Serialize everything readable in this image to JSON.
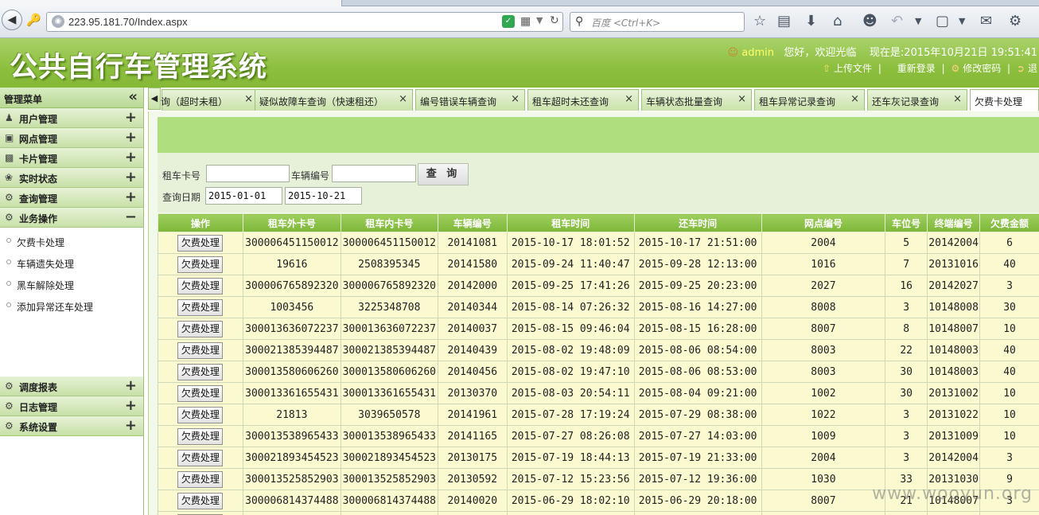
{
  "browser": {
    "url": "223.95.181.70/Index.aspx",
    "search_placeholder": "百度 <Ctrl+K>"
  },
  "app": {
    "title": "公共自行车管理系统",
    "user": "admin",
    "greeting": "您好，欢迎光临",
    "now_label": "现在是:2015年10月21日 19:51:41",
    "links": {
      "upload": "上传文件",
      "relogin": "重新登录",
      "change_password": "修改密码",
      "logout": "退"
    }
  },
  "sidebar": {
    "title": "管理菜单",
    "menus_top": [
      {
        "label": "用户管理",
        "toggle": "+"
      },
      {
        "label": "网点管理",
        "toggle": "+"
      },
      {
        "label": "卡片管理",
        "toggle": "+"
      },
      {
        "label": "实时状态",
        "toggle": "+"
      },
      {
        "label": "查询管理",
        "toggle": "+"
      },
      {
        "label": "业务操作",
        "toggle": "−"
      }
    ],
    "subitems": [
      "欠费卡处理",
      "车辆遗失处理",
      "黑车解除处理",
      "添加异常还车处理"
    ],
    "menus_bottom": [
      {
        "label": "调度报表",
        "toggle": "+"
      },
      {
        "label": "日志管理",
        "toggle": "+"
      },
      {
        "label": "系统设置",
        "toggle": "+"
      }
    ]
  },
  "tabs": [
    {
      "label": "询（超时未租）"
    },
    {
      "label": "疑似故障车查询（快速租还）"
    },
    {
      "label": "编号错误车辆查询"
    },
    {
      "label": "租车超时未还查询"
    },
    {
      "label": "车辆状态批量查询"
    },
    {
      "label": "租车异常记录查询"
    },
    {
      "label": "还车灰记录查询"
    },
    {
      "label": "欠费卡处理"
    }
  ],
  "query": {
    "card_label": "租车卡号",
    "card_value": "",
    "bike_label": "车辆编号",
    "bike_value": "",
    "button": "查 询",
    "date_label": "查询日期",
    "date_from": "2015-01-01",
    "date_to": "2015-10-21"
  },
  "table": {
    "headers": [
      "操作",
      "租车外卡号",
      "租车内卡号",
      "车辆编号",
      "租车时间",
      "还车时间",
      "网点编号",
      "车位号",
      "终端编号",
      "欠费金额"
    ],
    "action_label": "欠费处理",
    "rows": [
      [
        "300006451150012",
        "300006451150012",
        "20141081",
        "2015-10-17 18:01:52",
        "2015-10-17 21:51:00",
        "2004",
        "5",
        "20142004",
        "6"
      ],
      [
        "19616",
        "2508395345",
        "20141580",
        "2015-09-24 11:40:47",
        "2015-09-28 12:13:00",
        "1016",
        "7",
        "20131016",
        "40"
      ],
      [
        "300006765892320",
        "300006765892320",
        "20142000",
        "2015-09-25 17:41:26",
        "2015-09-25 20:23:00",
        "2027",
        "16",
        "20142027",
        "3"
      ],
      [
        "1003456",
        "3225348708",
        "20140344",
        "2015-08-14 07:26:32",
        "2015-08-16 14:27:00",
        "8008",
        "3",
        "10148008",
        "30"
      ],
      [
        "300013636072237",
        "300013636072237",
        "20140037",
        "2015-08-15 09:46:04",
        "2015-08-15 16:28:00",
        "8007",
        "8",
        "10148007",
        "10"
      ],
      [
        "300021385394487",
        "300021385394487",
        "20140439",
        "2015-08-02 19:48:09",
        "2015-08-06 08:54:00",
        "8003",
        "22",
        "10148003",
        "40"
      ],
      [
        "300013580606260",
        "300013580606260",
        "20140456",
        "2015-08-02 19:47:10",
        "2015-08-06 08:53:00",
        "8003",
        "30",
        "10148003",
        "40"
      ],
      [
        "300013361655431",
        "300013361655431",
        "20130370",
        "2015-08-03 20:54:11",
        "2015-08-04 09:21:00",
        "1002",
        "30",
        "20131002",
        "10"
      ],
      [
        "21813",
        "3039650578",
        "20141961",
        "2015-07-28 17:19:24",
        "2015-07-29 08:38:00",
        "1022",
        "3",
        "20131022",
        "10"
      ],
      [
        "300013538965433",
        "300013538965433",
        "20141165",
        "2015-07-27 08:26:08",
        "2015-07-27 14:03:00",
        "1009",
        "3",
        "20131009",
        "10"
      ],
      [
        "300021893454523",
        "300021893454523",
        "20130175",
        "2015-07-19 18:44:13",
        "2015-07-19 21:33:00",
        "2004",
        "3",
        "20142004",
        "3"
      ],
      [
        "300013525852903",
        "300013525852903",
        "20130592",
        "2015-07-12 15:23:56",
        "2015-07-12 19:36:00",
        "1030",
        "33",
        "20131030",
        "9"
      ],
      [
        "300006814374488",
        "300006814374488",
        "20140020",
        "2015-06-29 18:02:10",
        "2015-06-29 20:18:00",
        "8007",
        "21",
        "10148007",
        "3"
      ],
      [
        "",
        "",
        "",
        "",
        "",
        "",
        "",
        "",
        ""
      ]
    ]
  },
  "watermark": "www.wooyun.org"
}
